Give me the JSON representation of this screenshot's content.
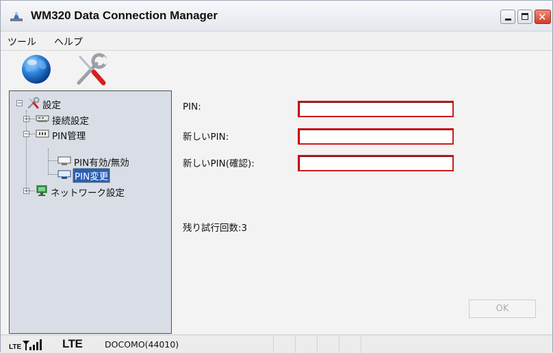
{
  "window": {
    "title": "WM320 Data Connection Manager"
  },
  "menu": {
    "items": [
      "ツール",
      "ヘルプ"
    ]
  },
  "toolbar": {
    "buttons": [
      {
        "icon": "globe-icon"
      },
      {
        "icon": "tools-icon"
      }
    ]
  },
  "tree": {
    "root": "設定",
    "items": [
      "接続設定",
      "PIN管理",
      "PIN有効/無効",
      "PIN変更",
      "ネットワーク設定"
    ],
    "selected": "PIN変更"
  },
  "form": {
    "pin_label": "PIN:",
    "new_pin_label": "新しいPIN:",
    "confirm_pin_label": "新しいPIN(確認):",
    "pin_value": "",
    "new_pin_value": "",
    "confirm_pin_value": "",
    "remaining_attempts": "残り試行回数:3",
    "ok_label": "OK"
  },
  "status": {
    "network_type": "LTE",
    "carrier": "DOCOMO(44010)"
  },
  "colors": {
    "error_border": "#d01818",
    "selection": "#2b5fb4",
    "tree_bg": "#d9dee6"
  }
}
